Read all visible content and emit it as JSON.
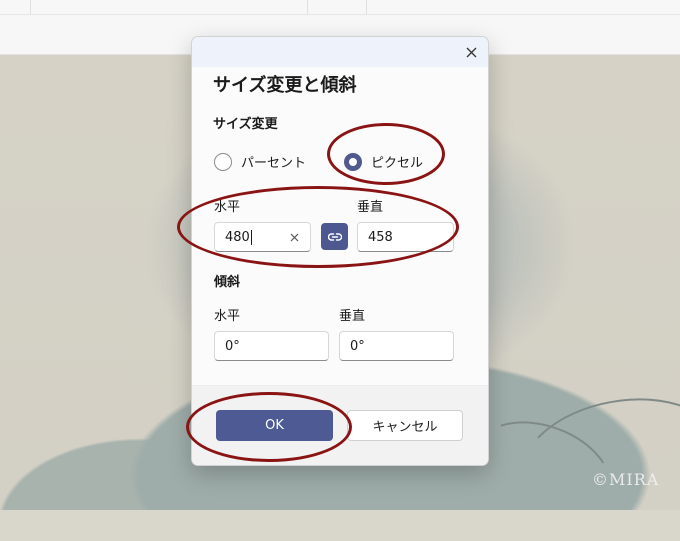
{
  "dialog": {
    "title": "サイズ変更と傾斜",
    "resize": {
      "heading": "サイズ変更",
      "options": [
        {
          "label": "パーセント",
          "checked": false
        },
        {
          "label": "ピクセル",
          "checked": true
        }
      ],
      "horizontal_label": "水平",
      "vertical_label": "垂直",
      "horizontal_value": "480",
      "vertical_value": "458"
    },
    "skew": {
      "heading": "傾斜",
      "horizontal_label": "水平",
      "vertical_label": "垂直",
      "horizontal_value": "0°",
      "vertical_value": "0°"
    },
    "ok_label": "OK",
    "cancel_label": "キャンセル"
  },
  "watermark": "©MIRA",
  "colors": {
    "accent": "#4e5a94",
    "annotation": "#8a1414"
  },
  "icons": {
    "close": "close-icon",
    "clear": "clear-icon",
    "link": "link-icon"
  }
}
